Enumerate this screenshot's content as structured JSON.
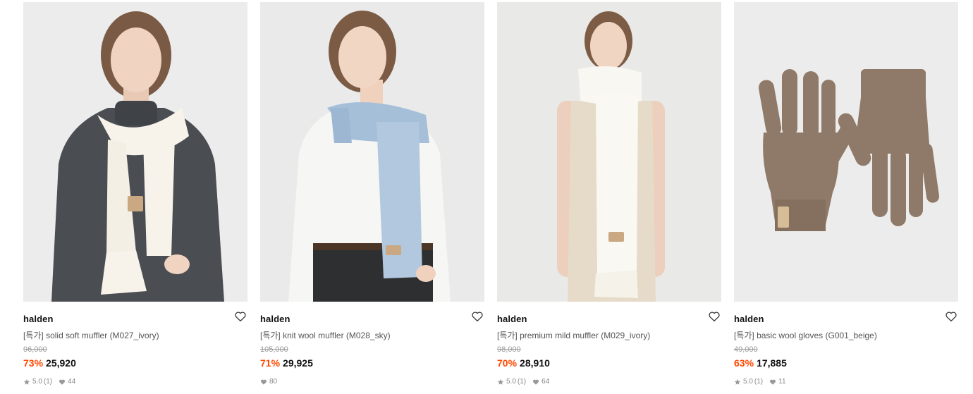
{
  "products": [
    {
      "brand": "halden",
      "name": "[특가] solid soft muffler (M027_ivory)",
      "original_price": "96,000",
      "discount": "73%",
      "price": "25,920",
      "rating": "5.0",
      "review_count": "(1)",
      "likes": "44",
      "image_icon": "model-ivory-scarf-image"
    },
    {
      "brand": "halden",
      "name": "[특가] knit wool muffler (M028_sky)",
      "original_price": "105,000",
      "discount": "71%",
      "price": "29,925",
      "likes": "80",
      "image_icon": "model-sky-scarf-image"
    },
    {
      "brand": "halden",
      "name": "[특가] premium mild muffler (M029_ivory)",
      "original_price": "98,000",
      "discount": "70%",
      "price": "28,910",
      "rating": "5.0",
      "review_count": "(1)",
      "likes": "64",
      "image_icon": "model-ivory-muffler-image"
    },
    {
      "brand": "halden",
      "name": "[특가] basic wool gloves (G001_beige)",
      "original_price": "49,000",
      "discount": "63%",
      "price": "17,885",
      "rating": "5.0",
      "review_count": "(1)",
      "likes": "11",
      "image_icon": "beige-gloves-image"
    }
  ],
  "colors": {
    "discount": "#ff4800",
    "brand_text": "#111111",
    "name_text": "#555555",
    "muted": "#999999"
  }
}
